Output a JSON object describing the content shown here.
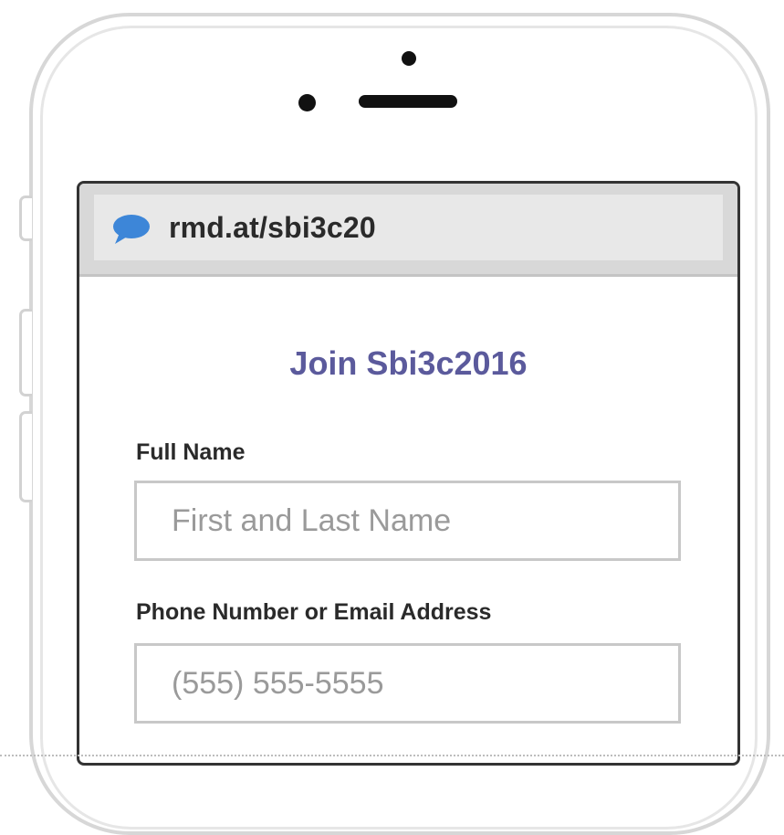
{
  "browser": {
    "url": "rmd.at/sbi3c20",
    "site_icon": "chat-bubble-icon"
  },
  "form": {
    "title": "Join Sbi3c2016",
    "full_name": {
      "label": "Full Name",
      "placeholder": "First and Last Name",
      "value": ""
    },
    "contact": {
      "label": "Phone Number or Email Address",
      "placeholder": "(555) 555-5555",
      "value": ""
    }
  },
  "colors": {
    "title": "#5b5a9c",
    "icon": "#3d86d8",
    "address_bar": "#d8d8d8",
    "input_border": "#c8c8c8"
  }
}
